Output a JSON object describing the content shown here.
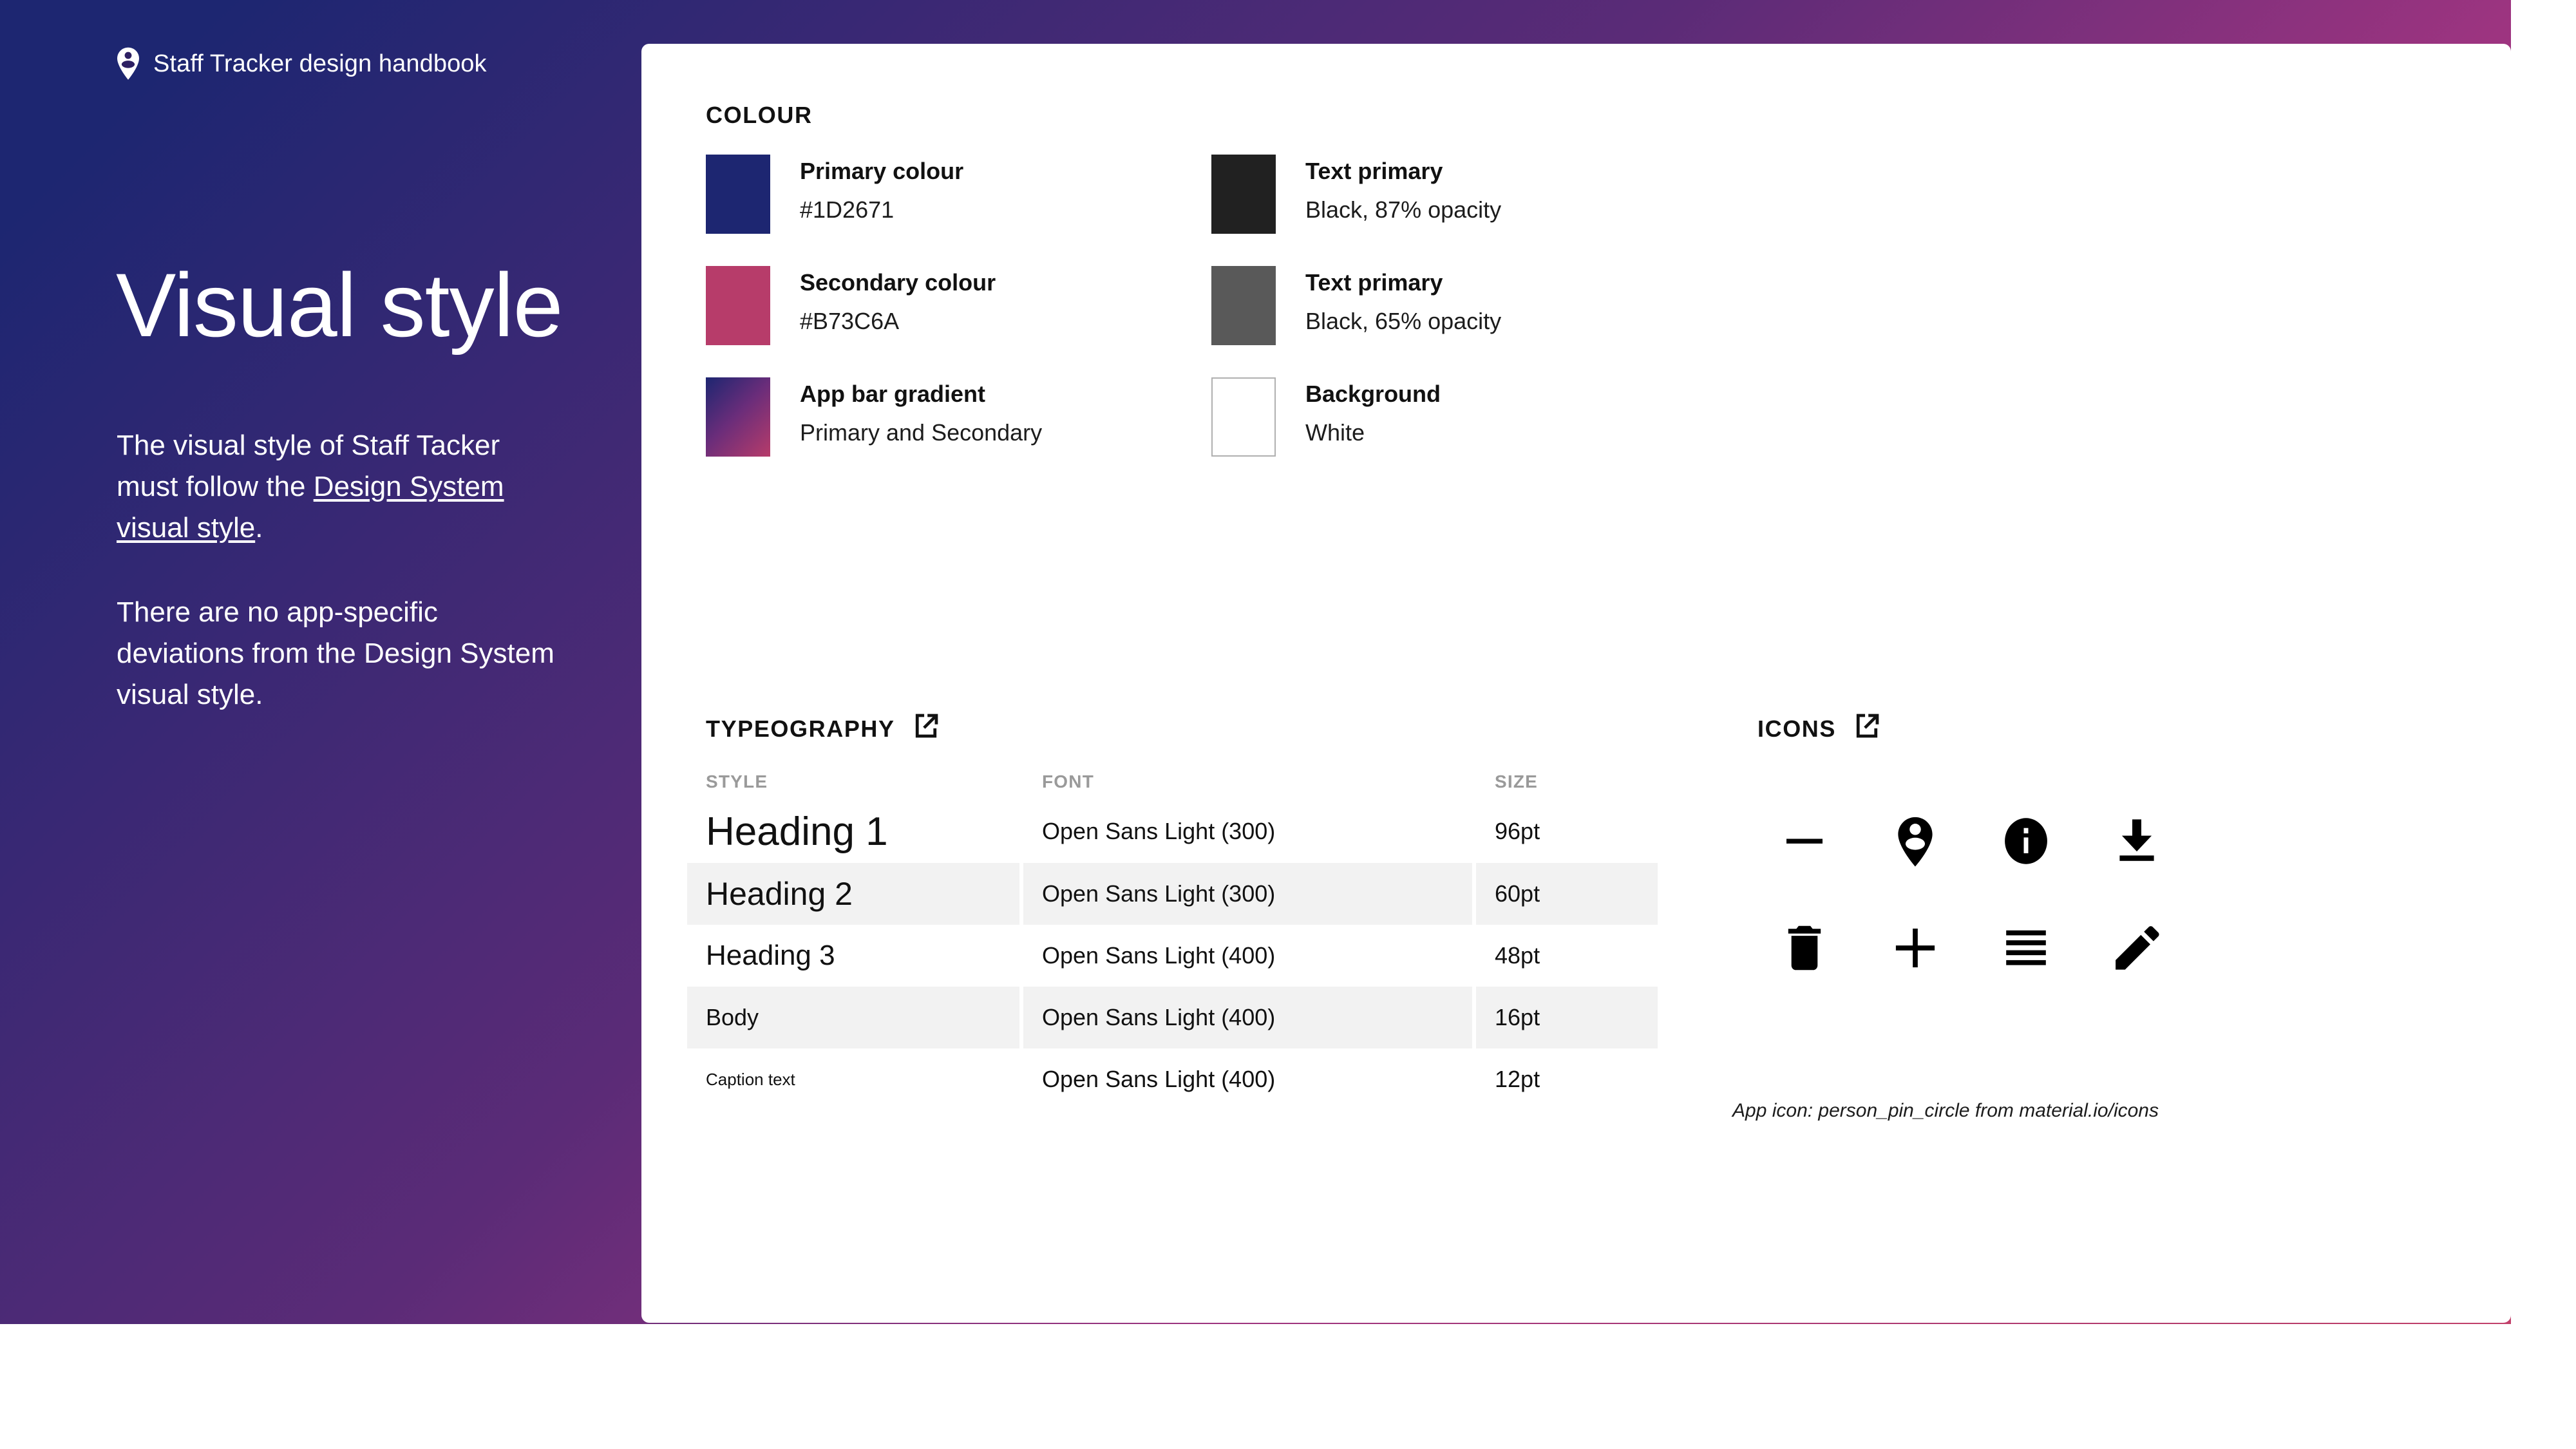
{
  "brand": {
    "logo_icon": "person-pin-icon",
    "title": "Staff Tracker design handbook"
  },
  "hero": {
    "heading": "Visual style",
    "paragraph1_before": "The visual style of Staff Tacker must follow the ",
    "paragraph1_link": "Design System visual style",
    "paragraph1_after": ".",
    "paragraph2": "There are no app-specific deviations from the Design System visual style."
  },
  "colour": {
    "section_label": "COLOUR",
    "swatches": [
      {
        "name": "Primary colour",
        "value": "#1D2671",
        "chip": "#1D2671",
        "outlined": false
      },
      {
        "name": "Text primary",
        "value": "Black, 87% opacity",
        "chip": "#212121",
        "outlined": false
      },
      {
        "name": "Secondary colour",
        "value": "#B73C6A",
        "chip": "#B73C6A",
        "outlined": false
      },
      {
        "name": "Text primary",
        "value": "Black, 65% opacity",
        "chip": "#595959",
        "outlined": false
      },
      {
        "name": "App bar gradient",
        "value": "Primary and Secondary",
        "chip": "gradient",
        "outlined": false
      },
      {
        "name": "Background",
        "value": "White",
        "chip": "#FFFFFF",
        "outlined": true
      }
    ]
  },
  "typography": {
    "section_label": "TYPEOGRAPHY",
    "launch_icon": "open-in-new-icon",
    "columns": [
      "STYLE",
      "FONT",
      "SIZE"
    ],
    "rows": [
      {
        "style": "Heading 1",
        "font": "Open Sans Light (300)",
        "size": "96pt"
      },
      {
        "style": "Heading 2",
        "font": "Open Sans Light (300)",
        "size": "60pt"
      },
      {
        "style": "Heading 3",
        "font": "Open Sans Light (400)",
        "size": "48pt"
      },
      {
        "style": "Body",
        "font": "Open Sans Light (400)",
        "size": "16pt"
      },
      {
        "style": "Caption text",
        "font": "Open Sans Light (400)",
        "size": "12pt"
      }
    ]
  },
  "icons": {
    "section_label": "ICONS",
    "launch_icon": "open-in-new-icon",
    "glyphs": [
      "remove-icon",
      "person-pin-icon",
      "info-icon",
      "download-icon",
      "delete-icon",
      "add-icon",
      "menu-icon",
      "edit-icon"
    ],
    "caption": "App icon: person_pin_circle from material.io/icons"
  }
}
